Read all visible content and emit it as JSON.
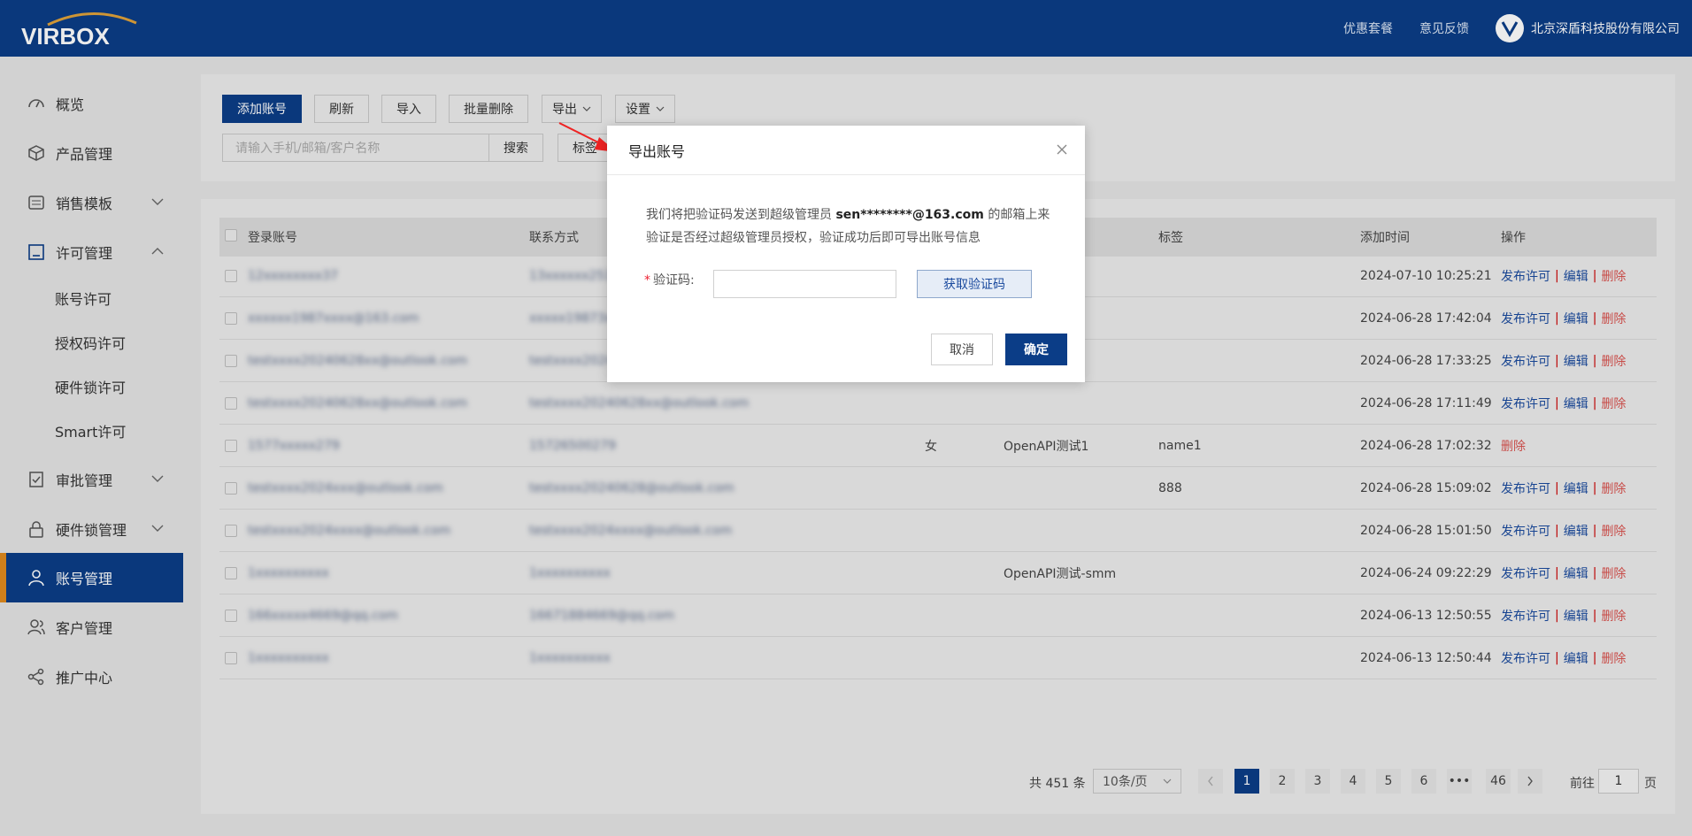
{
  "header": {
    "logo_text": "VIRBOX",
    "links": [
      "优惠套餐",
      "意见反馈"
    ],
    "company": "北京深盾科技股份有限公司"
  },
  "sidebar": {
    "items": [
      {
        "label": "概览",
        "icon": "dashboard-icon"
      },
      {
        "label": "产品管理",
        "icon": "box-icon"
      },
      {
        "label": "销售模板",
        "icon": "template-icon"
      },
      {
        "label": "许可管理",
        "icon": "license-icon"
      },
      {
        "label": "审批管理",
        "icon": "approval-icon"
      },
      {
        "label": "硬件锁管理",
        "icon": "lock-icon"
      },
      {
        "label": "账号管理",
        "icon": "user-icon"
      },
      {
        "label": "客户管理",
        "icon": "customer-icon"
      },
      {
        "label": "推广中心",
        "icon": "share-icon"
      }
    ],
    "license_subitems": [
      "账号许可",
      "授权码许可",
      "硬件锁许可",
      "Smart许可"
    ]
  },
  "toolbar": {
    "add": "添加账号",
    "refresh": "刷新",
    "import": "导入",
    "batch_delete": "批量删除",
    "export": "导出",
    "settings": "设置",
    "search_placeholder": "请输入手机/邮箱/客户名称",
    "search": "搜索",
    "tag": "标签"
  },
  "table": {
    "headers": {
      "account": "登录账号",
      "contact": "联系方式",
      "tag": "标签",
      "added": "添加时间",
      "actions": "操作"
    },
    "ops": {
      "publish": "发布许可",
      "edit": "编辑",
      "delete": "删除"
    },
    "rows": [
      {
        "account": "12xxxxxxxx37",
        "contact": "13xxxxxx251",
        "gender": "",
        "customer": "",
        "tag": "",
        "time": "2024-07-10 10:25:21",
        "ops": "full"
      },
      {
        "account": "xxxxxx1987xxxx@163.com",
        "contact": "xxxxx19873xx",
        "gender": "",
        "customer": "",
        "tag": "",
        "time": "2024-06-28 17:42:04",
        "ops": "full"
      },
      {
        "account": "testxxxx20240628xx@outlook.com",
        "contact": "testxxxx2024xx",
        "gender": "",
        "customer": "",
        "tag": "",
        "time": "2024-06-28 17:33:25",
        "ops": "full"
      },
      {
        "account": "testxxxx20240628xx@outlook.com",
        "contact": "testxxxx20240628xx@outlook.com",
        "gender": "",
        "customer": "",
        "tag": "",
        "time": "2024-06-28 17:11:49",
        "ops": "full"
      },
      {
        "account": "1577xxxxx279",
        "contact": "15726500279",
        "gender": "女",
        "customer": "OpenAPI测试1",
        "tag": "name1",
        "time": "2024-06-28 17:02:32",
        "ops": "delete"
      },
      {
        "account": "testxxxx2024xxx@outlook.com",
        "contact": "testxxxx20240628@outlook.com",
        "gender": "",
        "customer": "",
        "tag": "888",
        "time": "2024-06-28 15:09:02",
        "ops": "full"
      },
      {
        "account": "testxxxx2024xxxx@outlook.com",
        "contact": "testxxxx2024xxxx@outlook.com",
        "gender": "",
        "customer": "",
        "tag": "",
        "time": "2024-06-28 15:01:50",
        "ops": "full"
      },
      {
        "account": "1xxxxxxxxxx",
        "contact": "1xxxxxxxxxx",
        "gender": "",
        "customer": "OpenAPI测试-smm",
        "tag": "",
        "time": "2024-06-24 09:22:29",
        "ops": "full"
      },
      {
        "account": "166xxxxx4669@qq.com",
        "contact": "16671884669@qq.com",
        "gender": "",
        "customer": "",
        "tag": "",
        "time": "2024-06-13 12:50:55",
        "ops": "full"
      },
      {
        "account": "1xxxxxxxxxx",
        "contact": "1xxxxxxxxxx",
        "gender": "",
        "customer": "",
        "tag": "",
        "time": "2024-06-13 12:50:44",
        "ops": "full"
      }
    ]
  },
  "pagination": {
    "total": "共 451 条",
    "page_size": "10条/页",
    "pages": [
      "1",
      "2",
      "3",
      "4",
      "5",
      "6",
      "•••",
      "46"
    ],
    "current": "1",
    "goto_label": "前往",
    "goto_value": "1",
    "goto_suffix": "页"
  },
  "modal": {
    "title": "导出账号",
    "line1_a": "我们将把验证码发送到超级管理员",
    "line1_email": "sen********@163.com",
    "line1_b": "的邮箱上来",
    "line2": "验证是否经过超级管理员授权，验证成功后即可导出账号信息",
    "code_label": "验证码:",
    "get_code": "获取验证码",
    "cancel": "取消",
    "confirm": "确定"
  },
  "colors": {
    "primary": "#0b3d87",
    "accent": "#e08a1e",
    "danger": "#d9534f"
  }
}
